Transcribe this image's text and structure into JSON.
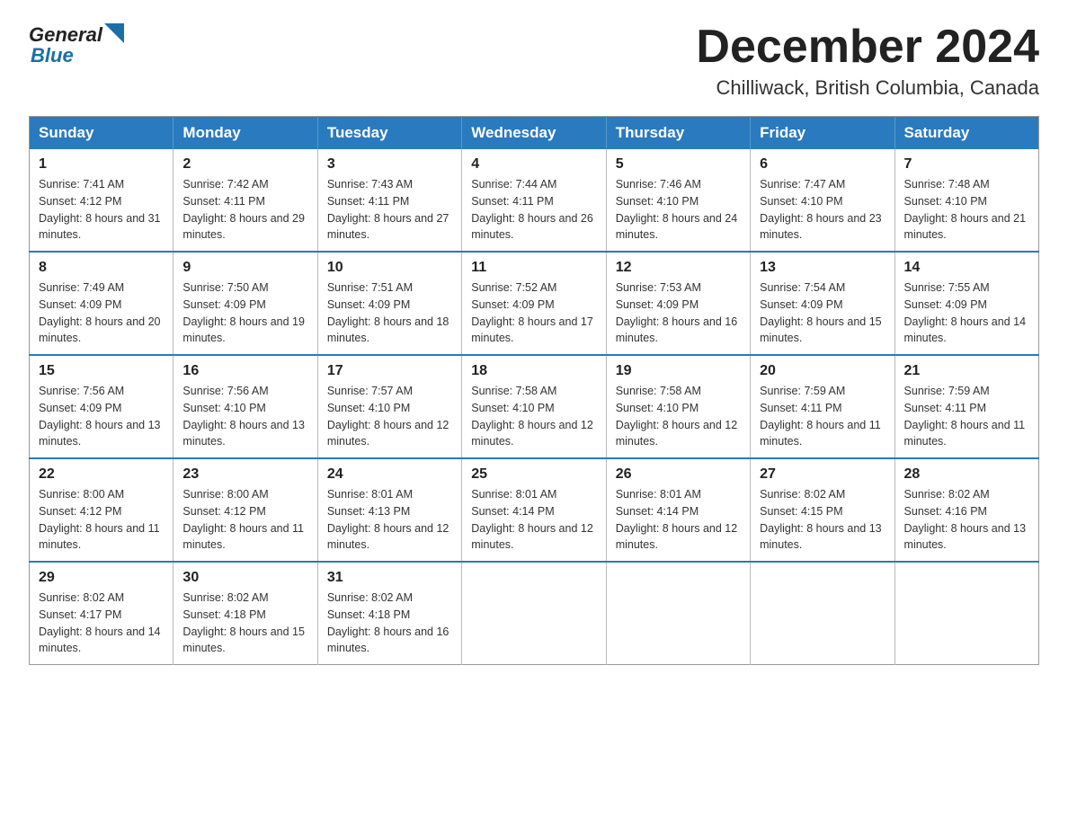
{
  "logo": {
    "general": "General",
    "blue": "Blue"
  },
  "header": {
    "month": "December 2024",
    "location": "Chilliwack, British Columbia, Canada"
  },
  "weekdays": [
    "Sunday",
    "Monday",
    "Tuesday",
    "Wednesday",
    "Thursday",
    "Friday",
    "Saturday"
  ],
  "weeks": [
    [
      {
        "day": "1",
        "sunrise": "Sunrise: 7:41 AM",
        "sunset": "Sunset: 4:12 PM",
        "daylight": "Daylight: 8 hours and 31 minutes."
      },
      {
        "day": "2",
        "sunrise": "Sunrise: 7:42 AM",
        "sunset": "Sunset: 4:11 PM",
        "daylight": "Daylight: 8 hours and 29 minutes."
      },
      {
        "day": "3",
        "sunrise": "Sunrise: 7:43 AM",
        "sunset": "Sunset: 4:11 PM",
        "daylight": "Daylight: 8 hours and 27 minutes."
      },
      {
        "day": "4",
        "sunrise": "Sunrise: 7:44 AM",
        "sunset": "Sunset: 4:11 PM",
        "daylight": "Daylight: 8 hours and 26 minutes."
      },
      {
        "day": "5",
        "sunrise": "Sunrise: 7:46 AM",
        "sunset": "Sunset: 4:10 PM",
        "daylight": "Daylight: 8 hours and 24 minutes."
      },
      {
        "day": "6",
        "sunrise": "Sunrise: 7:47 AM",
        "sunset": "Sunset: 4:10 PM",
        "daylight": "Daylight: 8 hours and 23 minutes."
      },
      {
        "day": "7",
        "sunrise": "Sunrise: 7:48 AM",
        "sunset": "Sunset: 4:10 PM",
        "daylight": "Daylight: 8 hours and 21 minutes."
      }
    ],
    [
      {
        "day": "8",
        "sunrise": "Sunrise: 7:49 AM",
        "sunset": "Sunset: 4:09 PM",
        "daylight": "Daylight: 8 hours and 20 minutes."
      },
      {
        "day": "9",
        "sunrise": "Sunrise: 7:50 AM",
        "sunset": "Sunset: 4:09 PM",
        "daylight": "Daylight: 8 hours and 19 minutes."
      },
      {
        "day": "10",
        "sunrise": "Sunrise: 7:51 AM",
        "sunset": "Sunset: 4:09 PM",
        "daylight": "Daylight: 8 hours and 18 minutes."
      },
      {
        "day": "11",
        "sunrise": "Sunrise: 7:52 AM",
        "sunset": "Sunset: 4:09 PM",
        "daylight": "Daylight: 8 hours and 17 minutes."
      },
      {
        "day": "12",
        "sunrise": "Sunrise: 7:53 AM",
        "sunset": "Sunset: 4:09 PM",
        "daylight": "Daylight: 8 hours and 16 minutes."
      },
      {
        "day": "13",
        "sunrise": "Sunrise: 7:54 AM",
        "sunset": "Sunset: 4:09 PM",
        "daylight": "Daylight: 8 hours and 15 minutes."
      },
      {
        "day": "14",
        "sunrise": "Sunrise: 7:55 AM",
        "sunset": "Sunset: 4:09 PM",
        "daylight": "Daylight: 8 hours and 14 minutes."
      }
    ],
    [
      {
        "day": "15",
        "sunrise": "Sunrise: 7:56 AM",
        "sunset": "Sunset: 4:09 PM",
        "daylight": "Daylight: 8 hours and 13 minutes."
      },
      {
        "day": "16",
        "sunrise": "Sunrise: 7:56 AM",
        "sunset": "Sunset: 4:10 PM",
        "daylight": "Daylight: 8 hours and 13 minutes."
      },
      {
        "day": "17",
        "sunrise": "Sunrise: 7:57 AM",
        "sunset": "Sunset: 4:10 PM",
        "daylight": "Daylight: 8 hours and 12 minutes."
      },
      {
        "day": "18",
        "sunrise": "Sunrise: 7:58 AM",
        "sunset": "Sunset: 4:10 PM",
        "daylight": "Daylight: 8 hours and 12 minutes."
      },
      {
        "day": "19",
        "sunrise": "Sunrise: 7:58 AM",
        "sunset": "Sunset: 4:10 PM",
        "daylight": "Daylight: 8 hours and 12 minutes."
      },
      {
        "day": "20",
        "sunrise": "Sunrise: 7:59 AM",
        "sunset": "Sunset: 4:11 PM",
        "daylight": "Daylight: 8 hours and 11 minutes."
      },
      {
        "day": "21",
        "sunrise": "Sunrise: 7:59 AM",
        "sunset": "Sunset: 4:11 PM",
        "daylight": "Daylight: 8 hours and 11 minutes."
      }
    ],
    [
      {
        "day": "22",
        "sunrise": "Sunrise: 8:00 AM",
        "sunset": "Sunset: 4:12 PM",
        "daylight": "Daylight: 8 hours and 11 minutes."
      },
      {
        "day": "23",
        "sunrise": "Sunrise: 8:00 AM",
        "sunset": "Sunset: 4:12 PM",
        "daylight": "Daylight: 8 hours and 11 minutes."
      },
      {
        "day": "24",
        "sunrise": "Sunrise: 8:01 AM",
        "sunset": "Sunset: 4:13 PM",
        "daylight": "Daylight: 8 hours and 12 minutes."
      },
      {
        "day": "25",
        "sunrise": "Sunrise: 8:01 AM",
        "sunset": "Sunset: 4:14 PM",
        "daylight": "Daylight: 8 hours and 12 minutes."
      },
      {
        "day": "26",
        "sunrise": "Sunrise: 8:01 AM",
        "sunset": "Sunset: 4:14 PM",
        "daylight": "Daylight: 8 hours and 12 minutes."
      },
      {
        "day": "27",
        "sunrise": "Sunrise: 8:02 AM",
        "sunset": "Sunset: 4:15 PM",
        "daylight": "Daylight: 8 hours and 13 minutes."
      },
      {
        "day": "28",
        "sunrise": "Sunrise: 8:02 AM",
        "sunset": "Sunset: 4:16 PM",
        "daylight": "Daylight: 8 hours and 13 minutes."
      }
    ],
    [
      {
        "day": "29",
        "sunrise": "Sunrise: 8:02 AM",
        "sunset": "Sunset: 4:17 PM",
        "daylight": "Daylight: 8 hours and 14 minutes."
      },
      {
        "day": "30",
        "sunrise": "Sunrise: 8:02 AM",
        "sunset": "Sunset: 4:18 PM",
        "daylight": "Daylight: 8 hours and 15 minutes."
      },
      {
        "day": "31",
        "sunrise": "Sunrise: 8:02 AM",
        "sunset": "Sunset: 4:18 PM",
        "daylight": "Daylight: 8 hours and 16 minutes."
      },
      null,
      null,
      null,
      null
    ]
  ]
}
